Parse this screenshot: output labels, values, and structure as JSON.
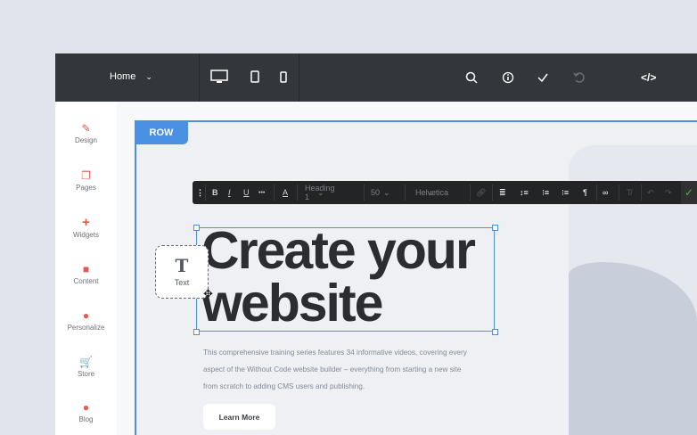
{
  "topbar": {
    "page": "Home",
    "icons": [
      "desktop-icon",
      "tablet-icon",
      "mobile-icon",
      "search-icon",
      "info-icon",
      "check-icon",
      "undo-icon",
      "code-icon"
    ]
  },
  "sidebar": {
    "items": [
      {
        "label": "Design",
        "icon": "pencil"
      },
      {
        "label": "Pages",
        "icon": "pages"
      },
      {
        "label": "Widgets",
        "icon": "plus"
      },
      {
        "label": "Content",
        "icon": "folder"
      },
      {
        "label": "Personalize",
        "icon": "user"
      },
      {
        "label": "Store",
        "icon": "cart"
      },
      {
        "label": "Blog",
        "icon": "bubble"
      }
    ]
  },
  "row_tag": "ROW",
  "toolbar": {
    "bold": "B",
    "italic": "I",
    "underline": "U",
    "more": "•••",
    "color": "A",
    "style": "Heading 1",
    "size": "50",
    "font": "Helvetica"
  },
  "content": {
    "headline_1": "Create your",
    "headline_2": "website",
    "description": "This comprehensive training series features 34 informative videos, covering every aspect of the Without Code website builder – everything from starting a new site from scratch to adding CMS users and publishing.",
    "button": "Learn More"
  },
  "drag_widget": {
    "icon": "T",
    "label": "Text"
  },
  "colors": {
    "accent": "#4a90e2",
    "sidebar_icon": "#e05a50",
    "topbar": "#33373c",
    "confirm": "#4caf50"
  }
}
